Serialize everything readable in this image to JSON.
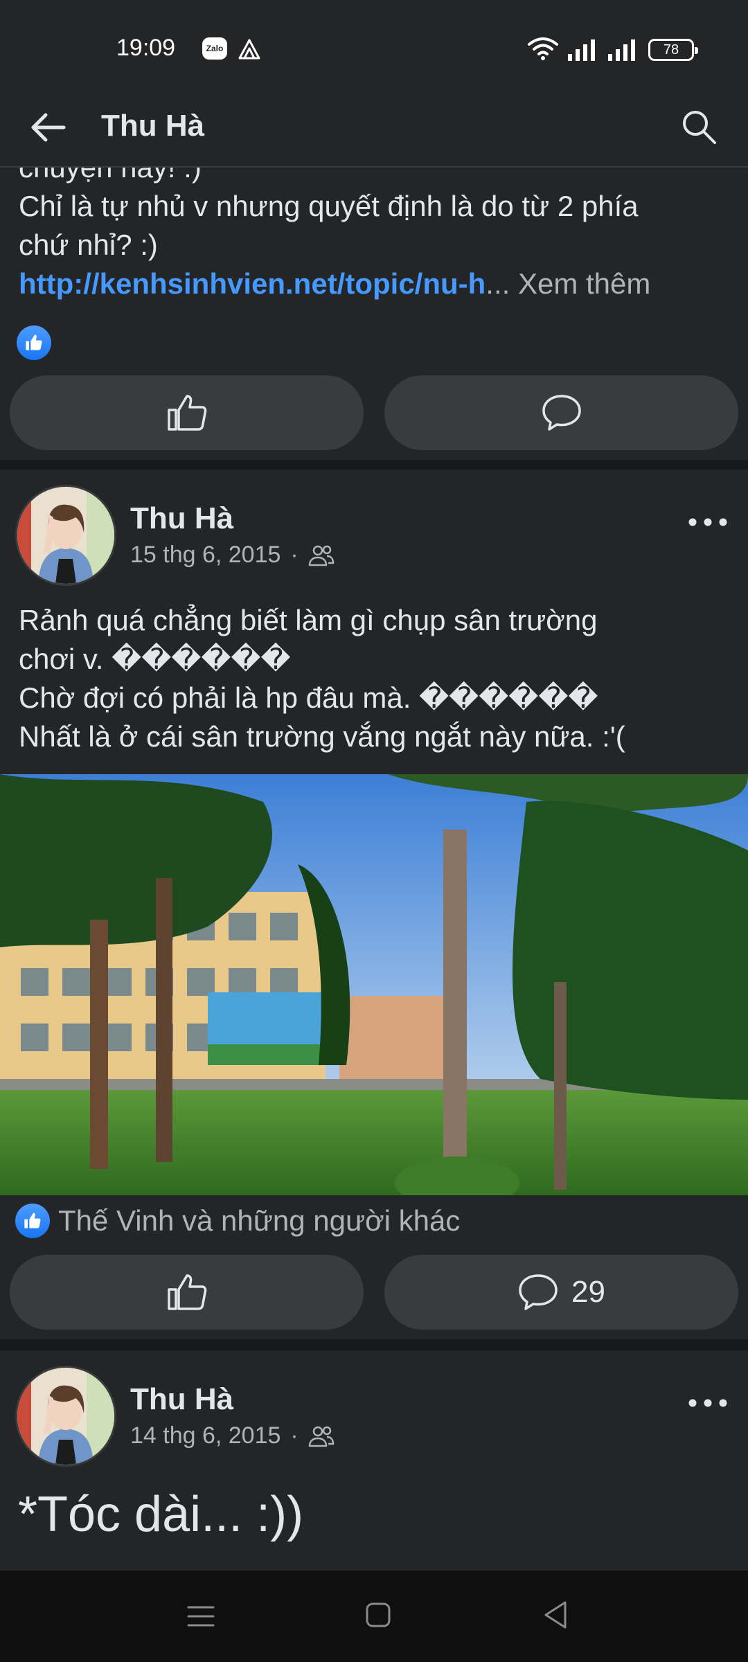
{
  "status_bar": {
    "time": "19:09",
    "zalo_label": "Zalo",
    "battery": "78"
  },
  "header": {
    "title": "Thu Hà"
  },
  "post1": {
    "cut_line": "chuyện này! :)",
    "lines": [
      "Chỉ là tự nhủ v nhưng quyết định là do từ 2 phía",
      "chứ nhỉ?  :)"
    ],
    "link": "http://kenhsinhvien.net/topic/nu-h",
    "ellipsis": "...",
    "see_more": "Xem thêm"
  },
  "post2": {
    "author": "Thu Hà",
    "date": "15 thg 6, 2015",
    "separator": "·",
    "lines": [
      "Rảnh quá chẳng biết làm gì chụp sân trường",
      "chơi v.  ������",
      "Chờ đợi có phải là hp đâu mà.  ������",
      "Nhất là ở cái sân trường vắng ngắt này nữa. :'("
    ],
    "reactions_text": "Thế Vinh và những người khác",
    "comment_count": "29"
  },
  "post3": {
    "author": "Thu Hà",
    "date": "14 thg 6, 2015",
    "separator": "·",
    "text": "*Tóc dài... :))"
  },
  "icons": {
    "back": "arrow-left-icon",
    "search": "search-icon",
    "like": "thumbs-up-icon",
    "comment": "speech-bubble-icon",
    "more": "ellipsis-icon",
    "audience": "friends-icon"
  },
  "colors": {
    "background": "#242526",
    "divider": "#18191a",
    "button": "#3a3b3c",
    "link": "#4599ff",
    "like_blue": "#1877f2",
    "text": "#e4e6eb",
    "muted": "#b0b3b8"
  }
}
